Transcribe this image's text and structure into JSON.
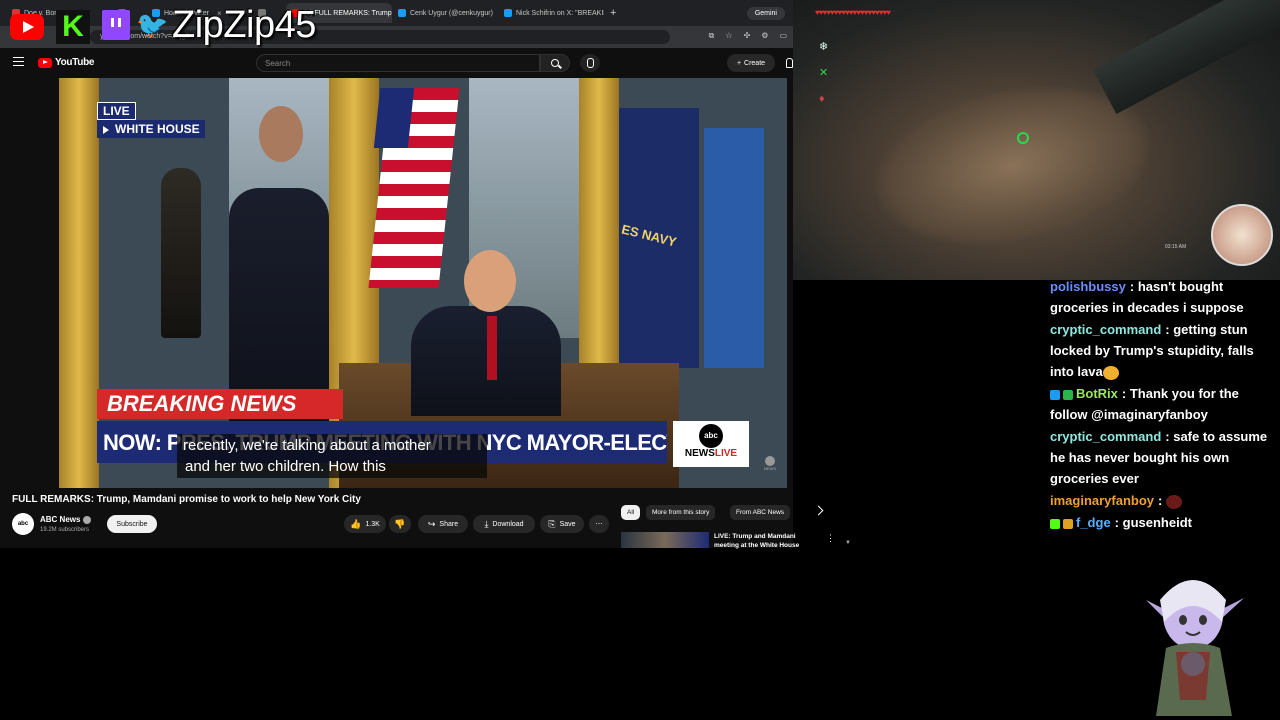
{
  "browser": {
    "tabs": [
      {
        "label": "Doe v. Bon",
        "color": "#d33"
      },
      {
        "label": "",
        "color": "#9146ff"
      },
      {
        "label": "Home / Twitter",
        "color": "#1d9bf0"
      },
      {
        "label": "",
        "color": "#777"
      },
      {
        "label": "(1) FULL REMARKS: Trump",
        "color": "#ff0000",
        "active": true
      },
      {
        "label": "Cenk Uygur (@cenkuygur)",
        "color": "#1d9bf0"
      },
      {
        "label": "Nick Schifrin on X: \"BREAKING",
        "color": "#1d9bf0"
      }
    ],
    "gemini_label": "Gemini",
    "url": "youtube.com/watch?v=...qgD"
  },
  "youtube": {
    "logo": "YouTube",
    "search_placeholder": "Search",
    "create_label": "Create"
  },
  "overlay": {
    "streamer_name": "ZipZip45",
    "kick_letter": "K",
    "twitter_glyph": "🐦"
  },
  "video": {
    "live_label": "LIVE",
    "location_label": "WHITE HOUSE",
    "breaking_label": "BREAKING NEWS",
    "lower_third": "NOW: PRES. TRUMP MEETING WITH NYC MAYOR-ELECT MAMDANI",
    "caption_line1": "recently, we're talking about a mother",
    "caption_line2": "and her two children. How this",
    "network_circle": "abc",
    "network_line_a": "NEWS",
    "network_line_b": "LIVE",
    "watermark": "NEWS",
    "flag_text": "ES NAVY"
  },
  "below_video": {
    "title": "FULL REMARKS: Trump, Mamdani promise to work to help New York City",
    "channel": "ABC News",
    "channel_avatar": "abc",
    "subscribers": "19.2M subscribers",
    "subscribe_label": "Subscribe",
    "like_count": "1.3K",
    "share_label": "Share",
    "download_label": "Download",
    "save_label": "Save",
    "chips": [
      "All",
      "More from this story",
      "From ABC News"
    ],
    "rec_title": "LIVE: Trump and Mamdani meeting at the White House"
  },
  "game": {
    "hearts": "♥♥♥♥♥♥♥♥♥♥♥♥♥♥♥♥♥♥♥♥",
    "time": "03:15 AM"
  },
  "chat": [
    {
      "user": "polishbussy",
      "color": "#6a8cff",
      "text": "hasn't bought groceries in decades i suppose"
    },
    {
      "user": "cryptic_command",
      "color": "#8ee8e0",
      "text": "getting stun locked by Trump's stupidity, falls into lava",
      "emote": "#f0b030"
    },
    {
      "user": "BotRix",
      "color": "#9be860",
      "text": "Thank you for the follow @imaginaryfanboy",
      "badges": [
        "#1d9bf0",
        "#2cb34a"
      ]
    },
    {
      "user": "cryptic_command",
      "color": "#8ee8e0",
      "text": "safe to assume he has never bought his own groceries ever"
    },
    {
      "user": "imaginaryfanboy",
      "color": "#f0a030",
      "text": "",
      "emote": "#6b1a1a"
    },
    {
      "user": "f_dge",
      "color": "#5ab0ff",
      "text": "gusenheidt",
      "badges": [
        "#53fc18",
        "#e0a020"
      ]
    }
  ]
}
